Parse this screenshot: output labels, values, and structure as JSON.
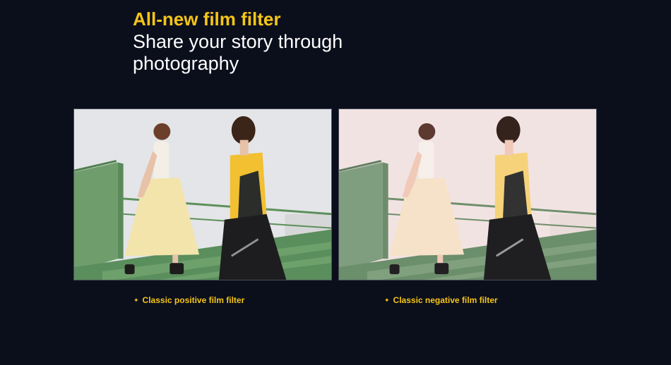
{
  "heading": {
    "title": "All-new film filter",
    "subtitle_line1": "Share your story through",
    "subtitle_line2": "photography"
  },
  "comparison": [
    {
      "caption": "Classic positive film filter",
      "bullet": "✦"
    },
    {
      "caption": "Classic negative film filter",
      "bullet": "✦"
    }
  ],
  "colors": {
    "background": "#0b0f1c",
    "accent": "#f5c518",
    "text": "#ffffff"
  }
}
